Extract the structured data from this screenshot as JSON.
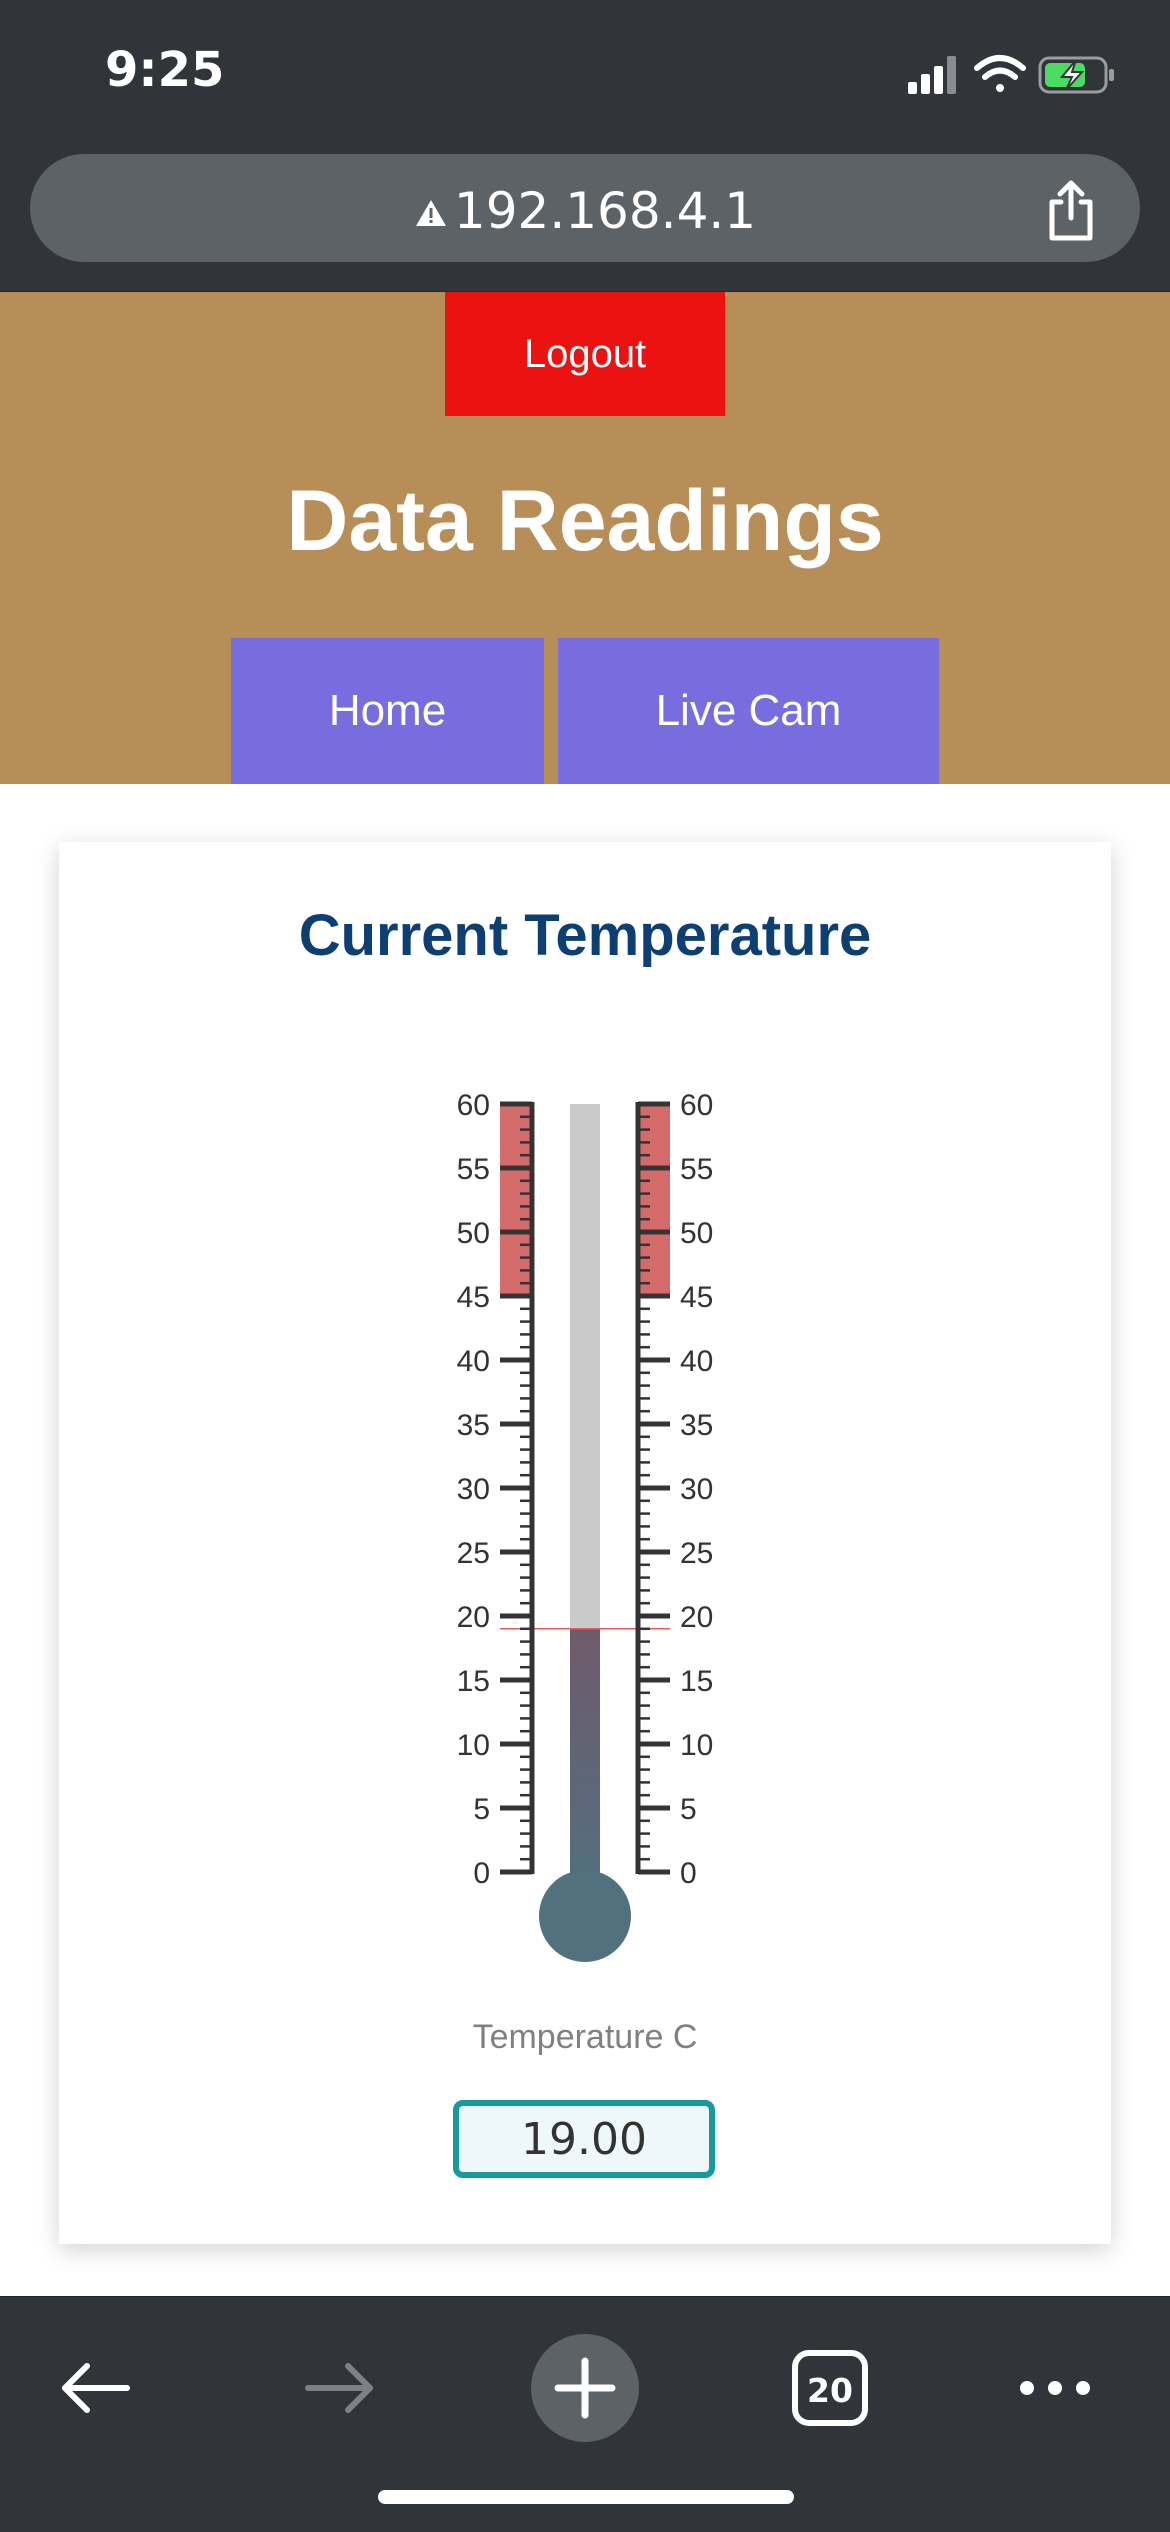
{
  "status_bar": {
    "time": "9:25"
  },
  "browser": {
    "url": "192.168.4.1",
    "tab_count": "20"
  },
  "header": {
    "logout_label": "Logout",
    "title": "Data Readings",
    "nav": {
      "home_label": "Home",
      "cam_label": "Live Cam"
    },
    "colors": {
      "header_bg": "#b78e57",
      "logout_bg": "#ec1212",
      "nav_bg": "#786ddf"
    }
  },
  "card": {
    "title": "Current Temperature",
    "gauge_label": "Temperature C",
    "value_display": "19.00"
  },
  "chart_data": {
    "type": "gauge",
    "min": 0,
    "max": 60,
    "major_step": 5,
    "minor_step": 1,
    "tick_labels": [
      "0",
      "5",
      "10",
      "15",
      "20",
      "25",
      "30",
      "35",
      "40",
      "45",
      "50",
      "55",
      "60"
    ],
    "value": 19,
    "warning_range": [
      45,
      60
    ],
    "colors": {
      "warning": "#d46b6b",
      "empty_tube": "#cacaca",
      "fill_top": "#6f5a6a",
      "fill_bottom": "#527080",
      "bulb": "#52717e",
      "value_marker": "#ec5a5a"
    }
  }
}
